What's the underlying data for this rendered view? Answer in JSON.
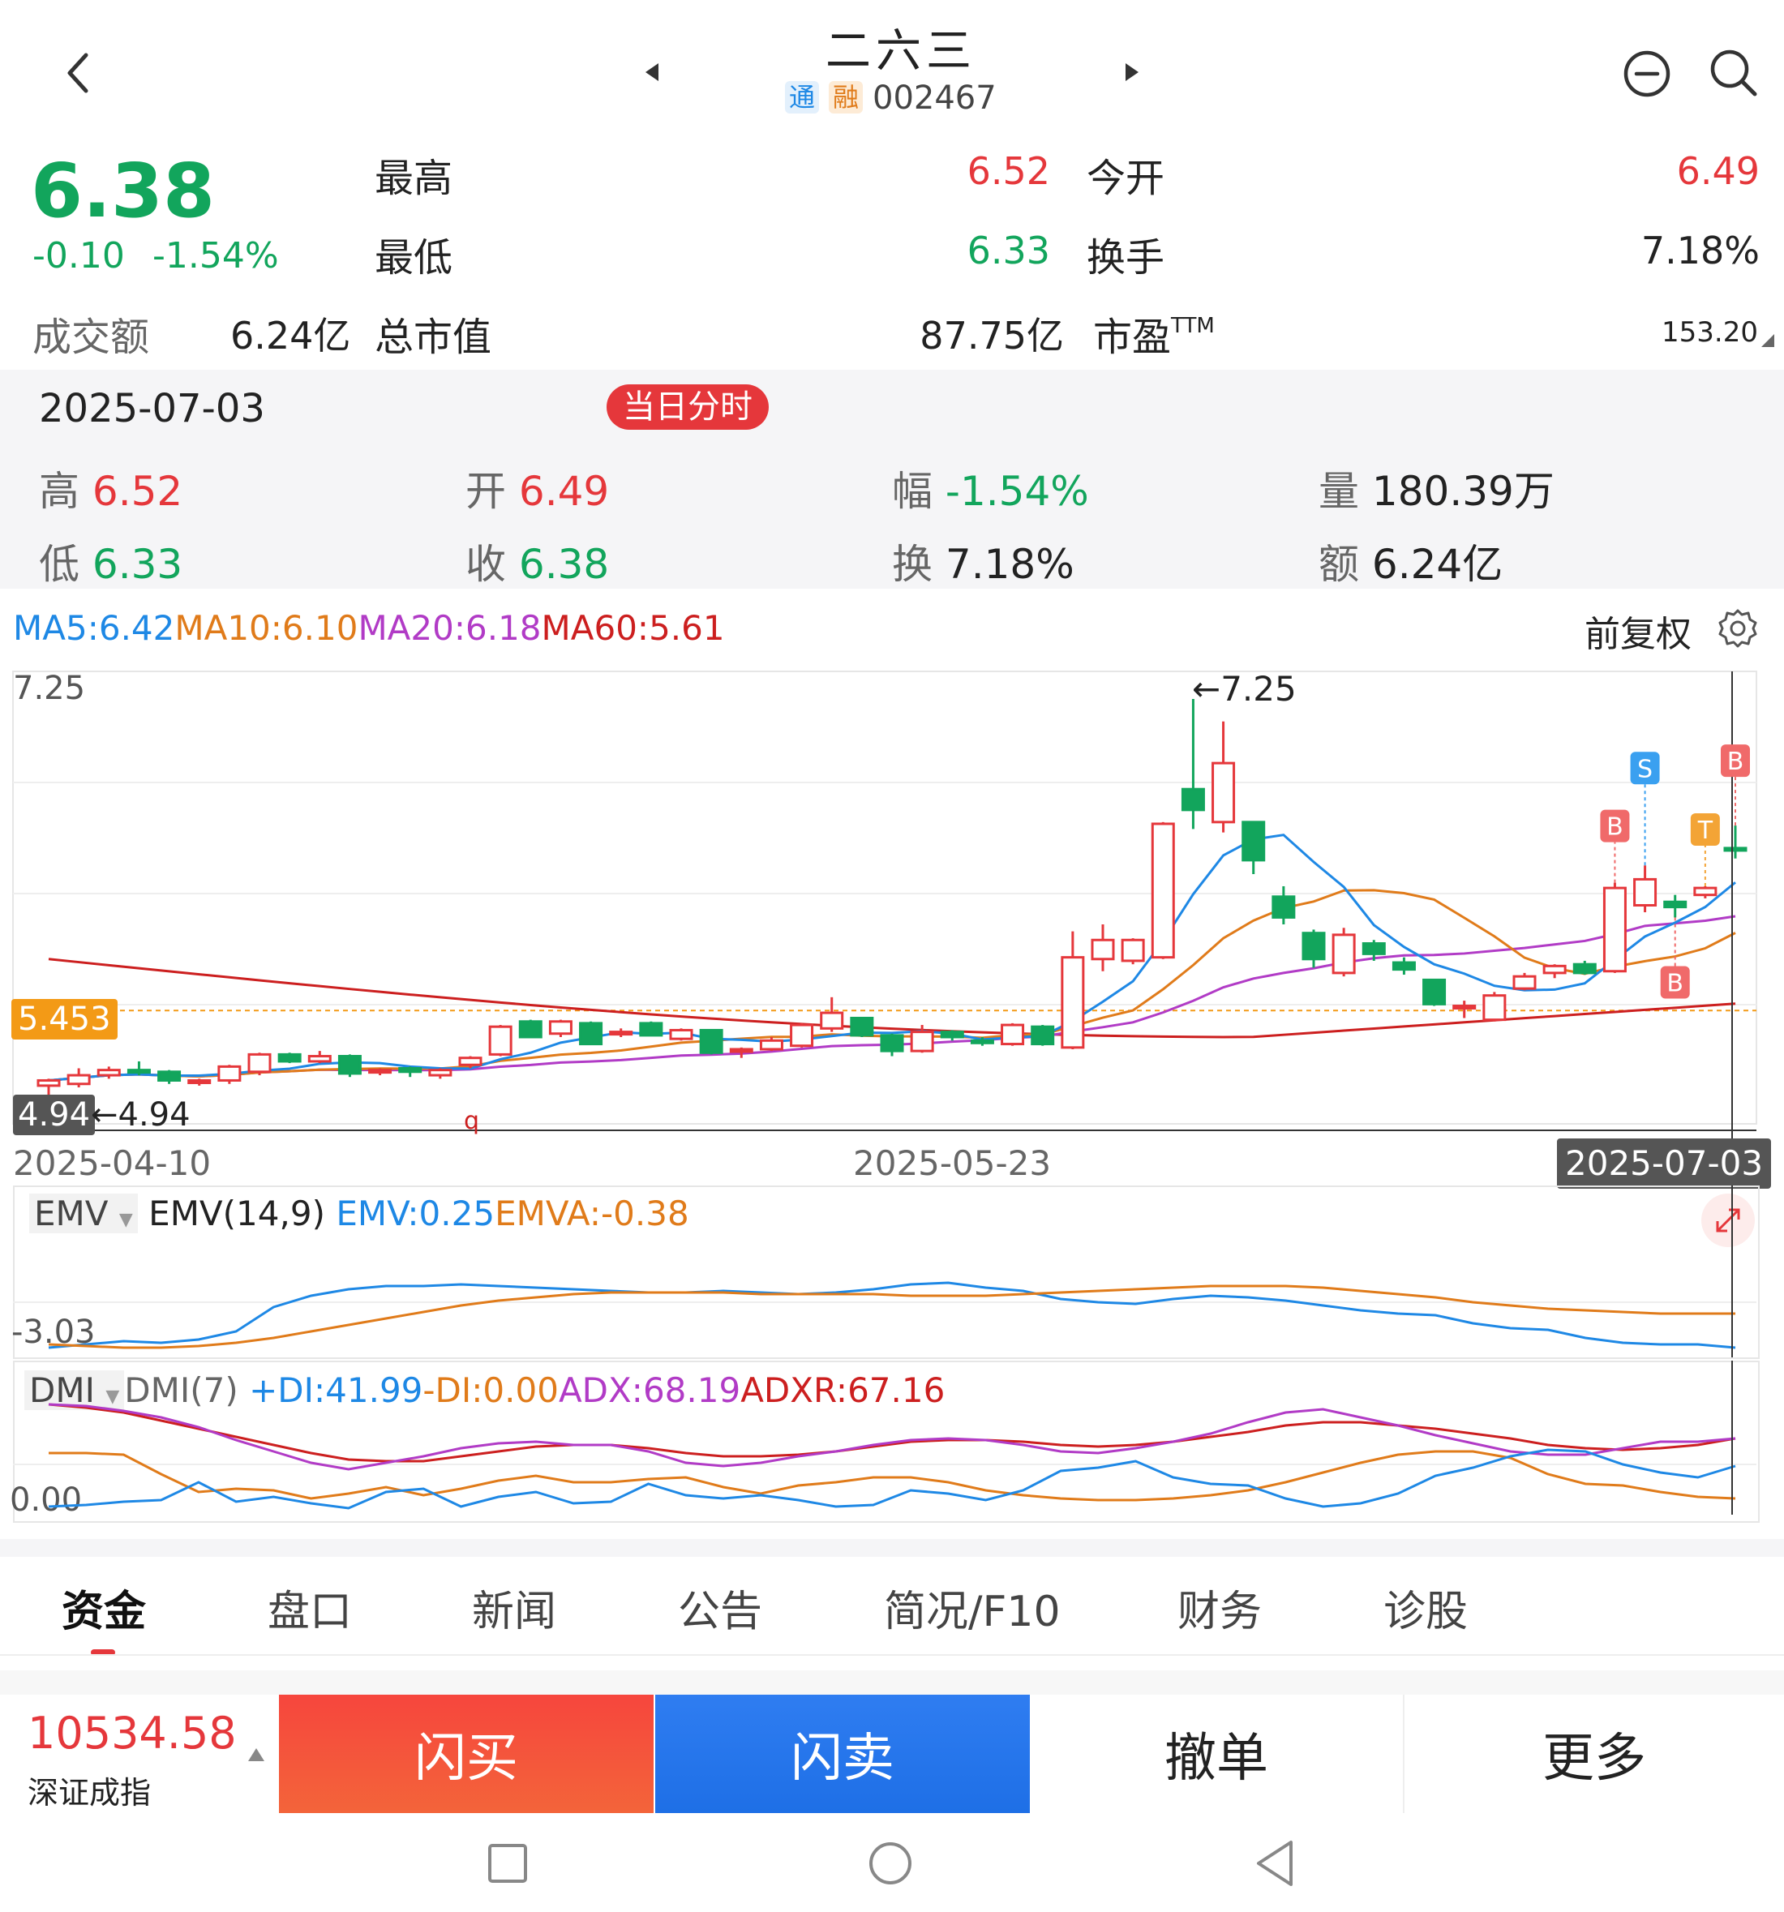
{
  "header": {
    "title": "二六三",
    "badge_tong": "通",
    "badge_rong": "融",
    "code": "002467"
  },
  "quote": {
    "price": "6.38",
    "change": "-0.10",
    "change_pct": "-1.54%",
    "high_label": "最高",
    "high": "6.52",
    "low_label": "最低",
    "low": "6.33",
    "open_label": "今开",
    "open": "6.49",
    "turnover_label": "换手",
    "turnover": "7.18%",
    "amount_label": "成交额",
    "amount": "6.24亿",
    "mktcap_label": "总市值",
    "mktcap": "87.75亿",
    "pe_label": "市盈",
    "pe_sup": "TTM",
    "pe": "153.20"
  },
  "day_panel": {
    "date": "2025-07-03",
    "intraday_button": "当日分时",
    "high_label": "高",
    "high": "6.52",
    "open_label": "开",
    "open": "6.49",
    "amp_label": "幅",
    "amp": "-1.54%",
    "vol_label": "量",
    "vol": "180.39万",
    "low_label": "低",
    "low": "6.33",
    "close_label": "收",
    "close": "6.38",
    "turn_label": "换",
    "turn": "7.18%",
    "amt_label": "额",
    "amt": "6.24亿"
  },
  "ma_legend": {
    "ma5": "MA5:6.42",
    "ma10": "MA10:6.10",
    "ma20": "MA20:6.18",
    "ma60": "MA60:5.61",
    "adjust": "前复权"
  },
  "chart_labels": {
    "max_label": "7.25",
    "max_marker": "←7.25",
    "ref_price": "5.453",
    "min_label": "4.94",
    "min_marker": "←4.94",
    "q_marker": "q",
    "date_start": "2025-04-10",
    "date_mid": "2025-05-23",
    "date_end": "2025-07-03",
    "signal_b1": "B",
    "signal_s": "S",
    "signal_t": "T",
    "signal_b2": "B",
    "signal_b3": "B"
  },
  "emv": {
    "name": "EMV",
    "params": "EMV(14,9)",
    "emv": "EMV:0.25",
    "emva": "EMVA:-0.38",
    "axis": "-3.03"
  },
  "dmi": {
    "name": "DMI",
    "params": "DMI(7)",
    "pdi": "+DI:41.99",
    "mdi": "-DI:0.00",
    "adx": "ADX:68.19",
    "adxr": "ADXR:67.16",
    "axis": "0.00"
  },
  "tabs": [
    "资金",
    "盘口",
    "新闻",
    "公告",
    "简况/F10",
    "财务",
    "诊股"
  ],
  "bottom": {
    "index_value": "10534.58",
    "index_name": "深证成指",
    "buy": "闪买",
    "sell": "闪卖",
    "cancel": "撤单",
    "more": "更多"
  },
  "colors": {
    "up": "#e5373b",
    "down": "#12a55c",
    "ma5": "#1e88e5",
    "ma10": "#e07b1a",
    "ma20": "#b13bc6",
    "ma60": "#cc1f1f"
  },
  "chart_data": {
    "type": "candlestick",
    "x_range": [
      "2025-04-10",
      "2025-07-03"
    ],
    "ylim": [
      4.94,
      7.25
    ],
    "candles": [
      {
        "o": 5.02,
        "h": 5.06,
        "l": 4.94,
        "c": 5.05
      },
      {
        "o": 5.03,
        "h": 5.12,
        "l": 5.01,
        "c": 5.08
      },
      {
        "o": 5.08,
        "h": 5.13,
        "l": 5.06,
        "c": 5.11
      },
      {
        "o": 5.11,
        "h": 5.16,
        "l": 5.08,
        "c": 5.1
      },
      {
        "o": 5.1,
        "h": 5.11,
        "l": 5.03,
        "c": 5.05
      },
      {
        "o": 5.04,
        "h": 5.06,
        "l": 5.02,
        "c": 5.05
      },
      {
        "o": 5.05,
        "h": 5.14,
        "l": 5.03,
        "c": 5.13
      },
      {
        "o": 5.1,
        "h": 5.21,
        "l": 5.08,
        "c": 5.2
      },
      {
        "o": 5.2,
        "h": 5.21,
        "l": 5.15,
        "c": 5.16
      },
      {
        "o": 5.16,
        "h": 5.22,
        "l": 5.15,
        "c": 5.19
      },
      {
        "o": 5.19,
        "h": 5.2,
        "l": 5.07,
        "c": 5.09
      },
      {
        "o": 5.1,
        "h": 5.12,
        "l": 5.08,
        "c": 5.11
      },
      {
        "o": 5.12,
        "h": 5.13,
        "l": 5.07,
        "c": 5.1
      },
      {
        "o": 5.08,
        "h": 5.12,
        "l": 5.06,
        "c": 5.11
      },
      {
        "o": 5.14,
        "h": 5.19,
        "l": 5.12,
        "c": 5.18
      },
      {
        "o": 5.2,
        "h": 5.37,
        "l": 5.19,
        "c": 5.36
      },
      {
        "o": 5.39,
        "h": 5.4,
        "l": 5.3,
        "c": 5.3
      },
      {
        "o": 5.32,
        "h": 5.4,
        "l": 5.3,
        "c": 5.39
      },
      {
        "o": 5.38,
        "h": 5.39,
        "l": 5.26,
        "c": 5.26
      },
      {
        "o": 5.33,
        "h": 5.35,
        "l": 5.3,
        "c": 5.33
      },
      {
        "o": 5.38,
        "h": 5.39,
        "l": 5.31,
        "c": 5.31
      },
      {
        "o": 5.29,
        "h": 5.35,
        "l": 5.28,
        "c": 5.34
      },
      {
        "o": 5.34,
        "h": 5.34,
        "l": 5.2,
        "c": 5.21
      },
      {
        "o": 5.22,
        "h": 5.24,
        "l": 5.18,
        "c": 5.23
      },
      {
        "o": 5.23,
        "h": 5.3,
        "l": 5.22,
        "c": 5.28
      },
      {
        "o": 5.25,
        "h": 5.38,
        "l": 5.24,
        "c": 5.37
      },
      {
        "o": 5.35,
        "h": 5.53,
        "l": 5.33,
        "c": 5.44
      },
      {
        "o": 5.41,
        "h": 5.41,
        "l": 5.3,
        "c": 5.31
      },
      {
        "o": 5.31,
        "h": 5.32,
        "l": 5.19,
        "c": 5.22
      },
      {
        "o": 5.22,
        "h": 5.37,
        "l": 5.21,
        "c": 5.33
      },
      {
        "o": 5.33,
        "h": 5.34,
        "l": 5.28,
        "c": 5.3
      },
      {
        "o": 5.28,
        "h": 5.3,
        "l": 5.25,
        "c": 5.27
      },
      {
        "o": 5.26,
        "h": 5.38,
        "l": 5.25,
        "c": 5.37
      },
      {
        "o": 5.36,
        "h": 5.37,
        "l": 5.25,
        "c": 5.26
      },
      {
        "o": 5.24,
        "h": 5.91,
        "l": 5.23,
        "c": 5.76
      },
      {
        "o": 5.75,
        "h": 5.95,
        "l": 5.68,
        "c": 5.86
      },
      {
        "o": 5.74,
        "h": 5.87,
        "l": 5.72,
        "c": 5.86
      },
      {
        "o": 5.76,
        "h": 6.54,
        "l": 5.75,
        "c": 6.53
      },
      {
        "o": 6.73,
        "h": 7.25,
        "l": 6.5,
        "c": 6.61
      },
      {
        "o": 6.54,
        "h": 7.12,
        "l": 6.48,
        "c": 6.88
      },
      {
        "o": 6.54,
        "h": 6.54,
        "l": 6.24,
        "c": 6.32
      },
      {
        "o": 6.11,
        "h": 6.17,
        "l": 5.95,
        "c": 5.99
      },
      {
        "o": 5.9,
        "h": 5.92,
        "l": 5.7,
        "c": 5.75
      },
      {
        "o": 5.67,
        "h": 5.93,
        "l": 5.65,
        "c": 5.89
      },
      {
        "o": 5.84,
        "h": 5.86,
        "l": 5.74,
        "c": 5.78
      },
      {
        "o": 5.73,
        "h": 5.76,
        "l": 5.66,
        "c": 5.69
      },
      {
        "o": 5.63,
        "h": 5.63,
        "l": 5.48,
        "c": 5.49
      },
      {
        "o": 5.48,
        "h": 5.51,
        "l": 5.41,
        "c": 5.48
      },
      {
        "o": 5.4,
        "h": 5.56,
        "l": 5.39,
        "c": 5.54
      },
      {
        "o": 5.58,
        "h": 5.67,
        "l": 5.57,
        "c": 5.65
      },
      {
        "o": 5.67,
        "h": 5.72,
        "l": 5.64,
        "c": 5.71
      },
      {
        "o": 5.72,
        "h": 5.74,
        "l": 5.66,
        "c": 5.67
      },
      {
        "o": 5.68,
        "h": 6.19,
        "l": 5.67,
        "c": 6.16
      },
      {
        "o": 6.06,
        "h": 6.29,
        "l": 6.02,
        "c": 6.21
      },
      {
        "o": 6.08,
        "h": 6.12,
        "l": 5.99,
        "c": 6.05
      },
      {
        "o": 6.12,
        "h": 6.17,
        "l": 6.1,
        "c": 6.16
      },
      {
        "o": 6.39,
        "h": 6.52,
        "l": 6.33,
        "c": 6.38
      }
    ],
    "ma60_ref": 5.453
  }
}
